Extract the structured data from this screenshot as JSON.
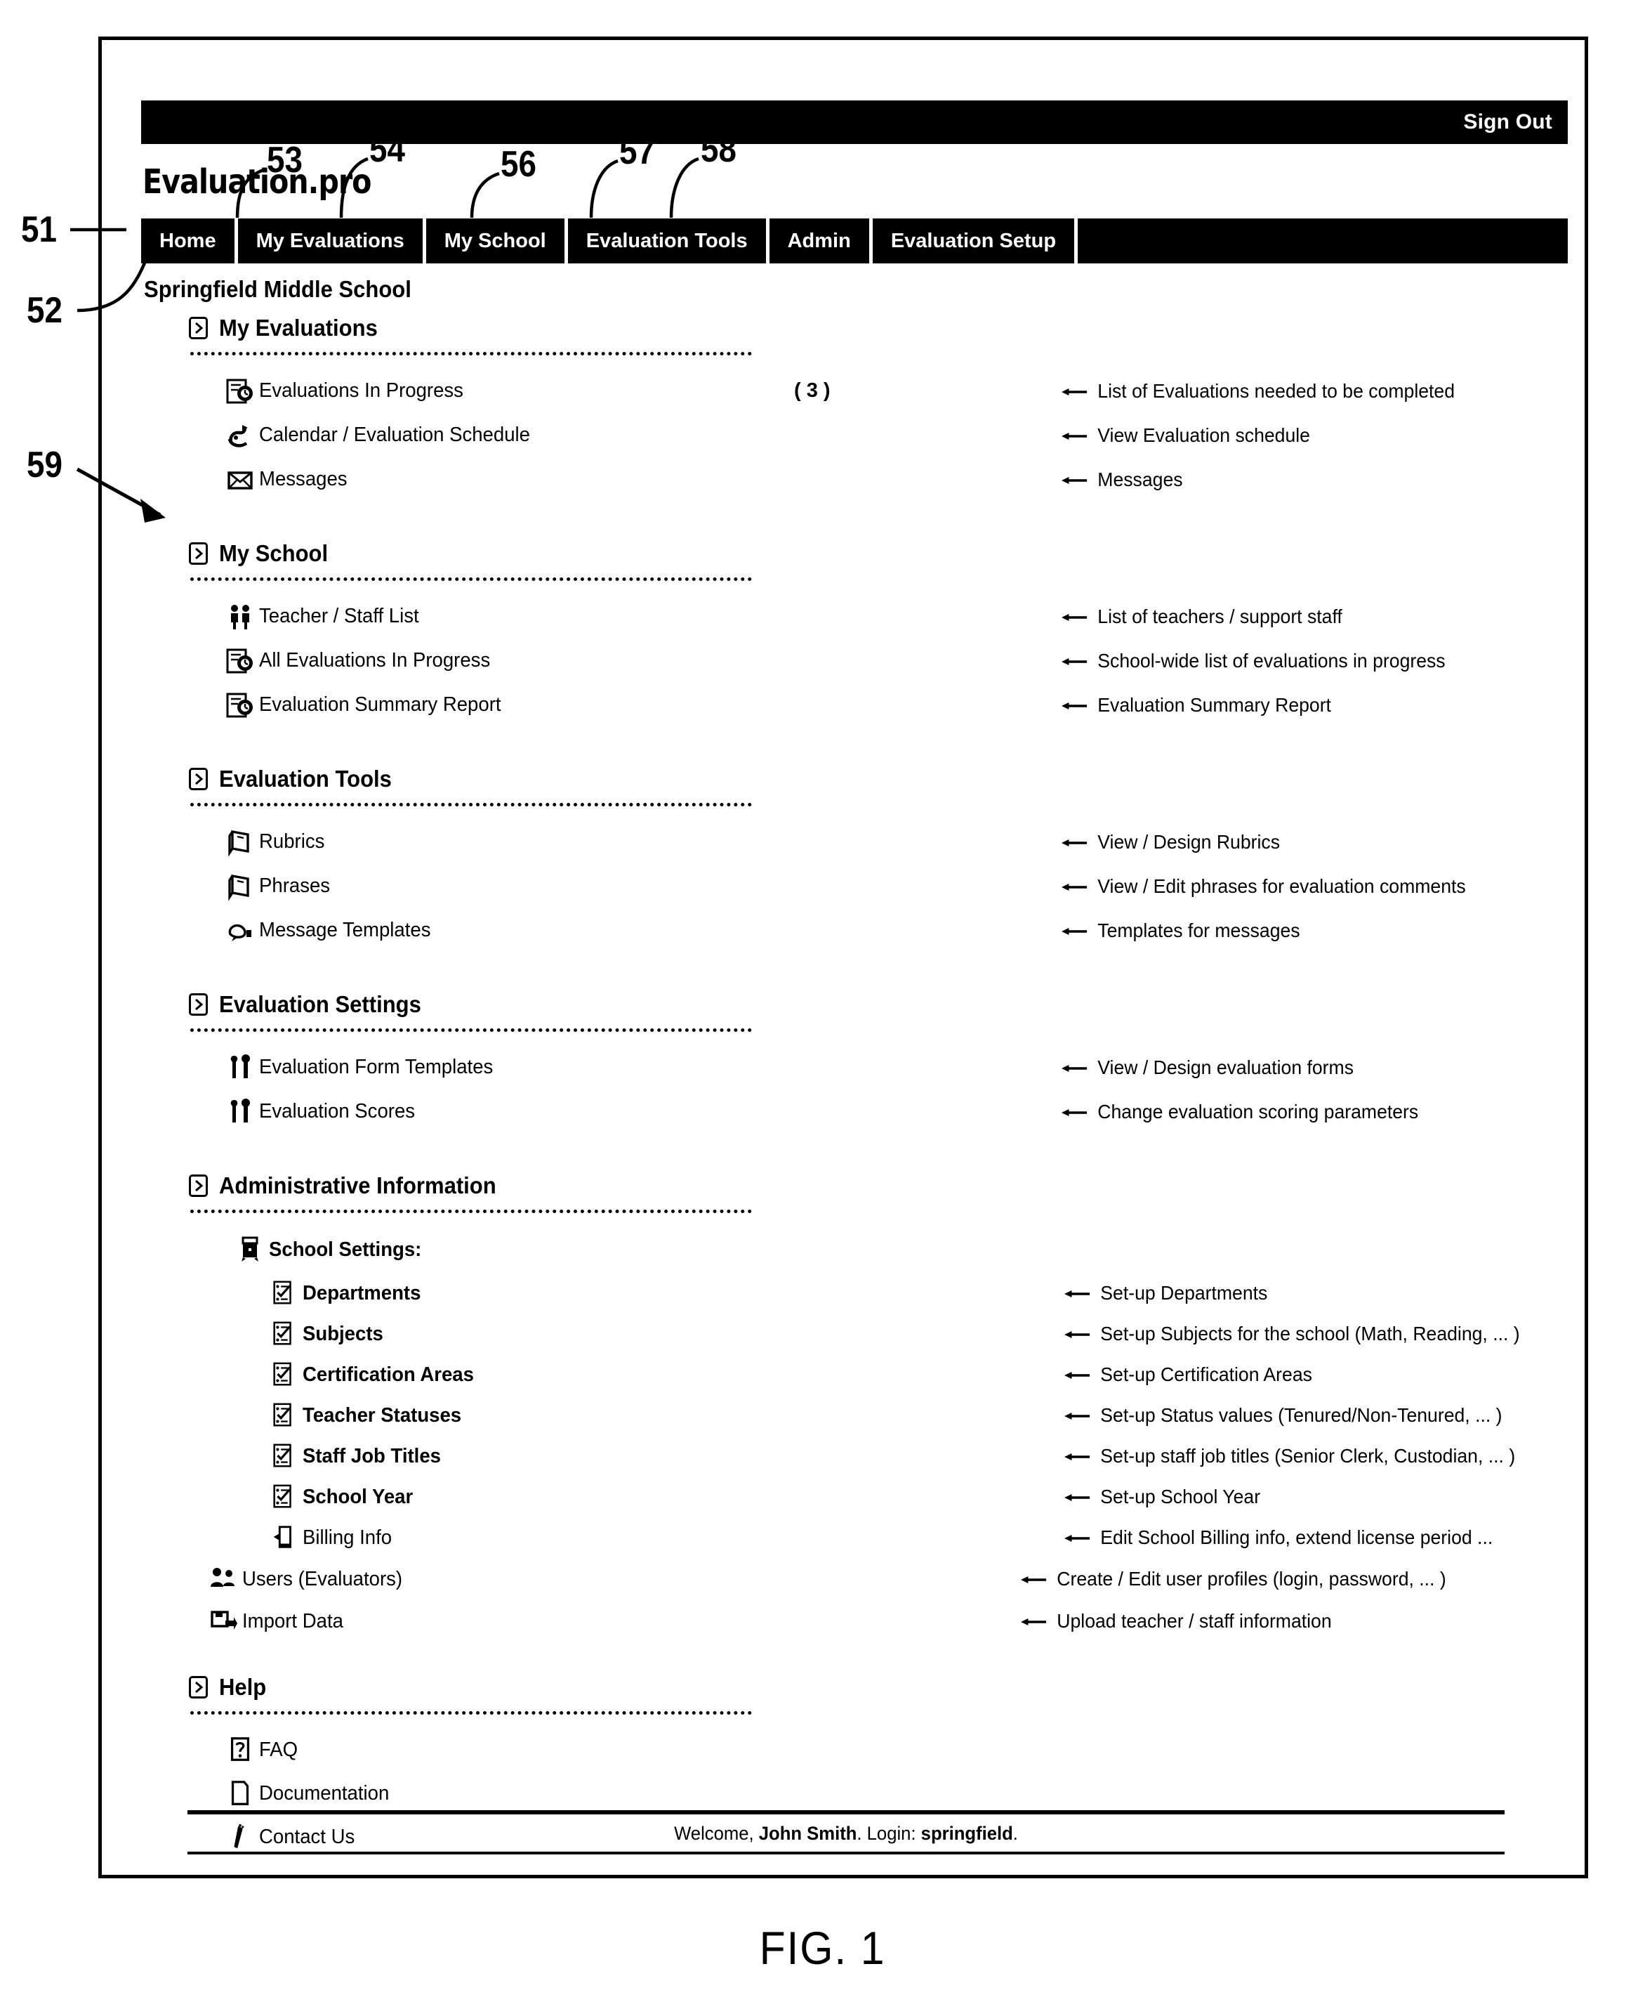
{
  "figure": {
    "label": "FIG. 1"
  },
  "topbar": {
    "signout_label": "Sign Out"
  },
  "brand": {
    "logo_text": "Evaluation.pro"
  },
  "nav": {
    "tabs": [
      {
        "label": "Home"
      },
      {
        "label": "My Evaluations"
      },
      {
        "label": "My School"
      },
      {
        "label": "Evaluation Tools"
      },
      {
        "label": "Admin"
      },
      {
        "label": "Evaluation Setup"
      }
    ]
  },
  "page": {
    "school_name": "Springfield Middle School"
  },
  "callouts": [
    {
      "num": "51"
    },
    {
      "num": "52"
    },
    {
      "num": "53"
    },
    {
      "num": "54"
    },
    {
      "num": "56"
    },
    {
      "num": "57"
    },
    {
      "num": "58"
    },
    {
      "num": "59"
    }
  ],
  "sections": [
    {
      "title": "My Evaluations",
      "items": [
        {
          "icon": "evaluation-in-progress-icon",
          "label": "Evaluations In Progress",
          "count": "( 3 )",
          "desc": "List of Evaluations needed to be completed"
        },
        {
          "icon": "calendar-icon",
          "label": "Calendar / Evaluation Schedule",
          "count": "",
          "desc": "View Evaluation schedule"
        },
        {
          "icon": "envelope-icon",
          "label": "Messages",
          "count": "",
          "desc": "Messages"
        }
      ]
    },
    {
      "title": "My School",
      "items": [
        {
          "icon": "people-icon",
          "label": "Teacher / Staff List",
          "count": "",
          "desc": "List of teachers / support staff"
        },
        {
          "icon": "evaluation-in-progress-icon",
          "label": "All Evaluations In Progress",
          "count": "",
          "desc": "School-wide list of evaluations in progress"
        },
        {
          "icon": "evaluation-report-icon",
          "label": "Evaluation Summary Report",
          "count": "",
          "desc": "Evaluation Summary Report"
        }
      ]
    },
    {
      "title": "Evaluation Tools",
      "items": [
        {
          "icon": "book-icon",
          "label": "Rubrics",
          "count": "",
          "desc": "View / Design Rubrics"
        },
        {
          "icon": "book-icon",
          "label": "Phrases",
          "count": "",
          "desc": "View / Edit phrases for evaluation comments"
        },
        {
          "icon": "message-template-icon",
          "label": "Message Templates",
          "count": "",
          "desc": "Templates for messages"
        }
      ]
    },
    {
      "title": "Evaluation Settings",
      "items": [
        {
          "icon": "tools-icon",
          "label": "Evaluation Form Templates",
          "count": "",
          "desc": "View / Design evaluation forms"
        },
        {
          "icon": "tools-icon",
          "label": "Evaluation Scores",
          "count": "",
          "desc": "Change evaluation scoring parameters"
        }
      ]
    },
    {
      "title": "Administrative Information",
      "group_header": {
        "icon": "building-icon",
        "label": "School Settings:"
      },
      "nested_items": [
        {
          "icon": "checklist-icon",
          "label": "Departments",
          "desc": "Set-up Departments"
        },
        {
          "icon": "checklist-icon",
          "label": "Subjects",
          "desc": "Set-up Subjects for the school (Math, Reading, ... )"
        },
        {
          "icon": "checklist-icon",
          "label": "Certification Areas",
          "desc": "Set-up Certification Areas"
        },
        {
          "icon": "checklist-icon",
          "label": "Teacher Statuses",
          "desc": "Set-up Status values (Tenured/Non-Tenured, ... )"
        },
        {
          "icon": "checklist-icon",
          "label": "Staff Job Titles",
          "desc": "Set-up staff job titles (Senior Clerk, Custodian, ... )"
        },
        {
          "icon": "checklist-icon",
          "label": "School Year",
          "desc": "Set-up School Year"
        },
        {
          "icon": "billing-icon",
          "label": "Billing Info",
          "desc": "Edit School Billing info, extend license period ..."
        }
      ],
      "items": [
        {
          "icon": "users-icon",
          "label": "Users (Evaluators)",
          "count": "",
          "desc": "Create / Edit user profiles (login, password, ... )"
        },
        {
          "icon": "import-data-icon",
          "label": "Import Data",
          "count": "",
          "desc": "Upload teacher / staff information"
        }
      ]
    },
    {
      "title": "Help",
      "items": [
        {
          "icon": "faq-icon",
          "label": "FAQ",
          "count": "",
          "desc": ""
        },
        {
          "icon": "document-icon",
          "label": "Documentation",
          "count": "",
          "desc": ""
        },
        {
          "icon": "contact-icon",
          "label": "Contact Us",
          "count": "",
          "desc": ""
        }
      ]
    }
  ],
  "footer": {
    "welcome_prefix": "Welcome, ",
    "user_name": "John Smith",
    "login_label": ". Login: ",
    "login_value": "springfield",
    "period": "."
  }
}
